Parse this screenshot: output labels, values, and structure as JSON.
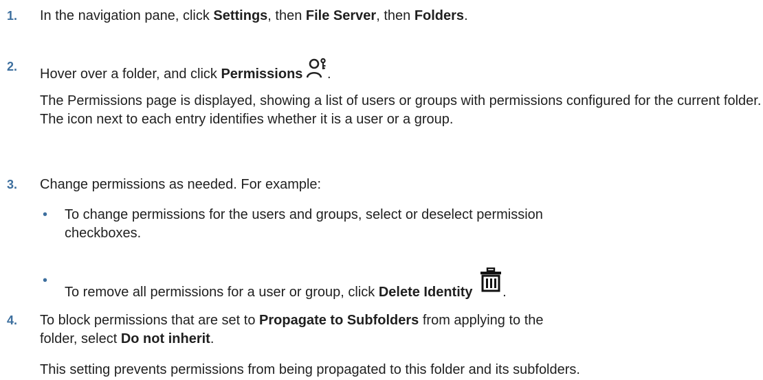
{
  "steps": [
    {
      "num": "1.",
      "parts": {
        "a": "In the navigation pane, click ",
        "b": "Settings",
        "c": ", then ",
        "d": "File Server",
        "e": ", then ",
        "f": "Folders",
        "g": "."
      }
    },
    {
      "num": "2.",
      "parts": {
        "a": "Hover over a folder, and click ",
        "b": "Permissions",
        "c": "."
      },
      "icon": "user-key-icon",
      "description": "The Permissions page is displayed, showing a list of users or groups with permissions configured for the current folder. The icon next to each entry identifies whether it is a user or a group."
    },
    {
      "num": "3.",
      "text": "Change permissions as needed. For example:",
      "bullets": [
        {
          "dot": "•",
          "text_line1": "To change permissions for the users and groups, select or deselect permission",
          "text_line2": "checkboxes."
        },
        {
          "dot": "•",
          "a": "To remove all permissions for a user or group, click ",
          "b": "Delete Identity",
          "c": ".",
          "icon": "trash-icon"
        }
      ]
    },
    {
      "num": "4.",
      "parts": {
        "a": "To block permissions that are set to ",
        "b": "Propagate to Subfolders",
        "c": " from applying to the",
        "d": "folder, select ",
        "e": "Do not inherit",
        "f": "."
      },
      "description": "This setting prevents permissions from being propagated to this folder and its subfolders."
    }
  ],
  "colors": {
    "accent": "#3d6f9e",
    "text": "#1f1f1f"
  }
}
